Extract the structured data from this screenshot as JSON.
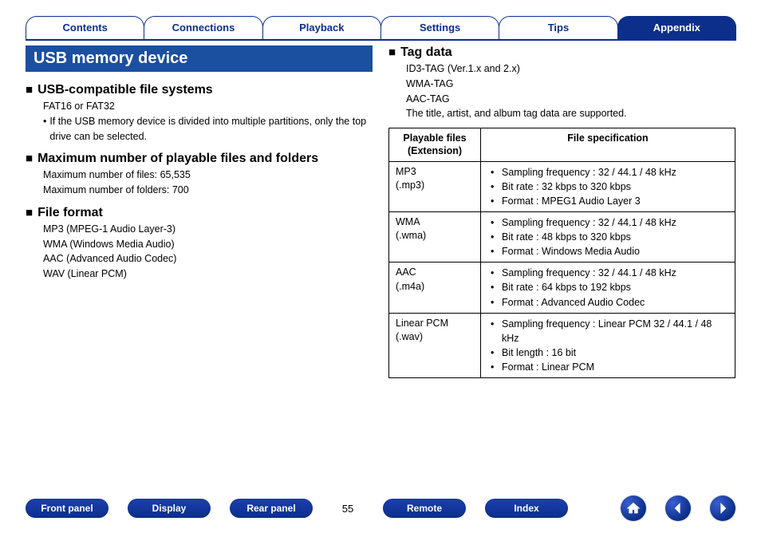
{
  "tabs": {
    "items": [
      {
        "label": "Contents",
        "active": false
      },
      {
        "label": "Connections",
        "active": false
      },
      {
        "label": "Playback",
        "active": false
      },
      {
        "label": "Settings",
        "active": false
      },
      {
        "label": "Tips",
        "active": false
      },
      {
        "label": "Appendix",
        "active": true
      }
    ]
  },
  "left": {
    "banner": "USB memory device",
    "sec1": {
      "heading": "USB-compatible file systems",
      "lines": [
        "FAT16 or FAT32"
      ],
      "bullets": [
        "If the USB memory device is divided into multiple partitions, only the top drive can be selected."
      ]
    },
    "sec2": {
      "heading": "Maximum number of playable files and folders",
      "lines": [
        "Maximum number of files: 65,535",
        "Maximum number of folders: 700"
      ]
    },
    "sec3": {
      "heading": "File format",
      "lines": [
        "MP3 (MPEG-1 Audio Layer-3)",
        "WMA (Windows Media Audio)",
        "AAC (Advanced Audio Codec)",
        "WAV (Linear PCM)"
      ]
    }
  },
  "right": {
    "heading": "Tag data",
    "lines": [
      "ID3-TAG (Ver.1.x and 2.x)",
      "WMA-TAG",
      "AAC-TAG",
      "The title, artist, and album tag data are supported."
    ],
    "table": {
      "head_col1_line1": "Playable files",
      "head_col1_line2": "(Extension)",
      "head_col2": "File specification",
      "rows": [
        {
          "name_l1": "MP3",
          "name_l2": "(.mp3)",
          "spec": [
            "Sampling frequency : 32 / 44.1 / 48 kHz",
            "Bit rate : 32 kbps to 320 kbps",
            "Format : MPEG1 Audio Layer 3"
          ]
        },
        {
          "name_l1": "WMA",
          "name_l2": "(.wma)",
          "spec": [
            "Sampling frequency : 32 / 44.1 / 48 kHz",
            "Bit rate : 48 kbps to 320 kbps",
            "Format : Windows Media Audio"
          ]
        },
        {
          "name_l1": "AAC",
          "name_l2": "(.m4a)",
          "spec": [
            "Sampling frequency : 32 / 44.1 / 48 kHz",
            "Bit rate : 64 kbps to 192 kbps",
            "Format : Advanced Audio Codec"
          ]
        },
        {
          "name_l1": "Linear PCM",
          "name_l2": "(.wav)",
          "spec": [
            "Sampling frequency : Linear PCM 32 / 44.1 / 48 kHz",
            "Bit length : 16 bit",
            "Format : Linear PCM"
          ]
        }
      ]
    }
  },
  "bottom": {
    "buttons_left": [
      "Front panel",
      "Display",
      "Rear panel"
    ],
    "page": "55",
    "buttons_right": [
      "Remote",
      "Index"
    ]
  }
}
